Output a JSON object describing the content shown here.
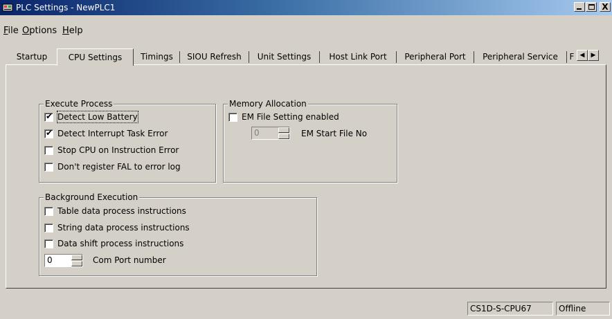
{
  "window": {
    "title": "PLC Settings - NewPLC1",
    "icon": "plc-settings-icon",
    "controls": {
      "minimize": "minimize-icon",
      "maximize": "maximize-icon",
      "close": "close-icon",
      "close_glyph": "X"
    }
  },
  "menu": [
    {
      "accel": "F",
      "rest": "ile"
    },
    {
      "accel": "O",
      "rest": "ptions"
    },
    {
      "accel": "H",
      "rest": "elp"
    }
  ],
  "tabs": [
    "Startup",
    "CPU Settings",
    "Timings",
    "SIOU Refresh",
    "Unit Settings",
    "Host Link Port",
    "Peripheral Port",
    "Peripheral Service",
    "F"
  ],
  "active_tab": "CPU Settings",
  "tab_scroll": {
    "left": "◀",
    "right": "▶"
  },
  "execute_process": {
    "title": "Execute Process",
    "options": [
      {
        "label": "Detect Low Battery",
        "checked": true
      },
      {
        "label": "Detect Interrupt Task Error",
        "checked": true
      },
      {
        "label": "Stop CPU on Instruction Error",
        "checked": false
      },
      {
        "label": "Don't register FAL to error log",
        "checked": false
      }
    ]
  },
  "memory_allocation": {
    "title": "Memory Allocation",
    "em_file_setting": {
      "label": "EM File Setting enabled",
      "checked": false
    },
    "em_start_file": {
      "value": "0",
      "label": "EM Start File No",
      "enabled": false
    }
  },
  "background_execution": {
    "title": "Background Execution",
    "options": [
      {
        "label": "Table data process instructions",
        "checked": false
      },
      {
        "label": "String data process instructions",
        "checked": false
      },
      {
        "label": "Data shift process instructions",
        "checked": false
      }
    ],
    "com_port": {
      "value": "0",
      "label": "Com Port number"
    }
  },
  "status_bar": {
    "model": "CS1D-S-CPU67",
    "connection": "Offline"
  },
  "check_glyph": "✔"
}
